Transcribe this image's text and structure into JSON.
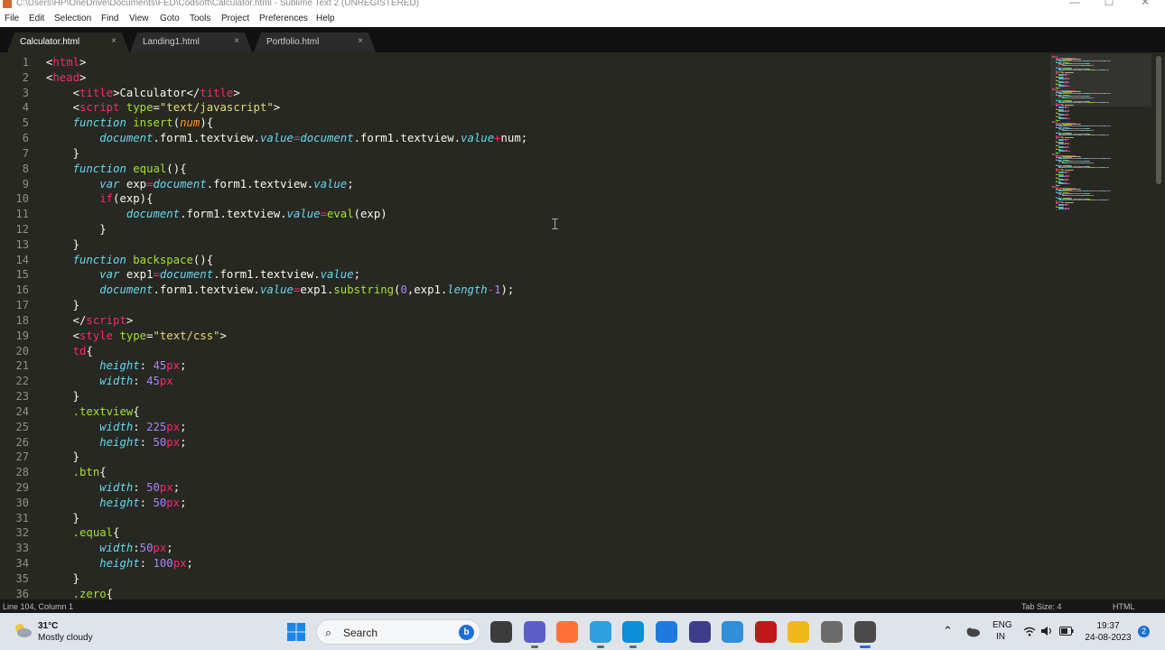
{
  "window": {
    "title": "C:\\Users\\HP\\OneDrive\\Documents\\FED\\Codsoft\\Calculator.html - Sublime Text 2 (UNREGISTERED)",
    "minimize": "—",
    "maximize": "☐",
    "close": "✕"
  },
  "menu": [
    "File",
    "Edit",
    "Selection",
    "Find",
    "View",
    "Goto",
    "Tools",
    "Project",
    "Preferences",
    "Help"
  ],
  "tabs": [
    {
      "label": "Calculator.html",
      "active": true,
      "close": "×"
    },
    {
      "label": "Landing1.html",
      "active": false,
      "close": "×"
    },
    {
      "label": "Portfolio.html",
      "active": false,
      "close": "×"
    }
  ],
  "line_numbers": [
    "1",
    "2",
    "3",
    "4",
    "5",
    "6",
    "7",
    "8",
    "9",
    "10",
    "11",
    "12",
    "13",
    "14",
    "15",
    "16",
    "17",
    "18",
    "19",
    "20",
    "21",
    "22",
    "23",
    "24",
    "25",
    "26",
    "27",
    "28",
    "29",
    "30",
    "31",
    "32",
    "33",
    "34",
    "35",
    "36"
  ],
  "code_lines": [
    [
      [
        "p",
        "<"
      ],
      [
        "tag",
        "html"
      ],
      [
        "p",
        ">"
      ]
    ],
    [
      [
        "p",
        "<"
      ],
      [
        "tag",
        "head"
      ],
      [
        "p",
        ">"
      ]
    ],
    [
      [
        "p",
        "    <"
      ],
      [
        "tag",
        "title"
      ],
      [
        "p",
        ">Calculator</"
      ],
      [
        "tag",
        "title"
      ],
      [
        "p",
        ">"
      ]
    ],
    [
      [
        "p",
        "    <"
      ],
      [
        "tag",
        "script"
      ],
      [
        "p",
        " "
      ],
      [
        "fn",
        "type"
      ],
      [
        "p",
        "="
      ],
      [
        "str",
        "\"text/javascript\""
      ],
      [
        "p",
        ">"
      ]
    ],
    [
      [
        "p",
        "    "
      ],
      [
        "kw",
        "function"
      ],
      [
        "p",
        " "
      ],
      [
        "fn",
        "insert"
      ],
      [
        "p",
        "("
      ],
      [
        "arg",
        "num"
      ],
      [
        "p",
        "){"
      ]
    ],
    [
      [
        "p",
        "        "
      ],
      [
        "builtin",
        "document"
      ],
      [
        "p",
        ".form1.textview."
      ],
      [
        "prop",
        "value"
      ],
      [
        "op",
        "="
      ],
      [
        "builtin",
        "document"
      ],
      [
        "p",
        ".form1.textview."
      ],
      [
        "prop",
        "value"
      ],
      [
        "op",
        "+"
      ],
      [
        "p",
        "num;"
      ]
    ],
    [
      [
        "p",
        "    }"
      ]
    ],
    [
      [
        "p",
        "    "
      ],
      [
        "kw",
        "function"
      ],
      [
        "p",
        " "
      ],
      [
        "fn",
        "equal"
      ],
      [
        "p",
        "(){"
      ]
    ],
    [
      [
        "p",
        "        "
      ],
      [
        "kwv",
        "var"
      ],
      [
        "p",
        " exp"
      ],
      [
        "op",
        "="
      ],
      [
        "builtin",
        "document"
      ],
      [
        "p",
        ".form1.textview."
      ],
      [
        "prop",
        "value"
      ],
      [
        "p",
        ";"
      ]
    ],
    [
      [
        "p",
        "        "
      ],
      [
        "ctrl",
        "if"
      ],
      [
        "p",
        "(exp){"
      ]
    ],
    [
      [
        "p",
        "            "
      ],
      [
        "builtin",
        "document"
      ],
      [
        "p",
        ".form1.textview."
      ],
      [
        "prop",
        "value"
      ],
      [
        "op",
        "="
      ],
      [
        "fn",
        "eval"
      ],
      [
        "p",
        "(exp)"
      ]
    ],
    [
      [
        "p",
        "        }"
      ]
    ],
    [
      [
        "p",
        "    }"
      ]
    ],
    [
      [
        "p",
        "    "
      ],
      [
        "kw",
        "function"
      ],
      [
        "p",
        " "
      ],
      [
        "fn",
        "backspace"
      ],
      [
        "p",
        "(){"
      ]
    ],
    [
      [
        "p",
        "        "
      ],
      [
        "kwv",
        "var"
      ],
      [
        "p",
        " exp1"
      ],
      [
        "op",
        "="
      ],
      [
        "builtin",
        "document"
      ],
      [
        "p",
        ".form1.textview."
      ],
      [
        "prop",
        "value"
      ],
      [
        "p",
        ";"
      ]
    ],
    [
      [
        "p",
        "        "
      ],
      [
        "builtin",
        "document"
      ],
      [
        "p",
        ".form1.textview."
      ],
      [
        "prop",
        "value"
      ],
      [
        "op",
        "="
      ],
      [
        "p",
        "exp1."
      ],
      [
        "fn",
        "substring"
      ],
      [
        "p",
        "("
      ],
      [
        "num",
        "0"
      ],
      [
        "p",
        ",exp1."
      ],
      [
        "prop",
        "length"
      ],
      [
        "op",
        "-"
      ],
      [
        "num",
        "1"
      ],
      [
        "p",
        ");"
      ]
    ],
    [
      [
        "p",
        "    }"
      ]
    ],
    [
      [
        "p",
        "    </"
      ],
      [
        "tag",
        "script"
      ],
      [
        "p",
        ">"
      ]
    ],
    [
      [
        "p",
        "    <"
      ],
      [
        "tag",
        "style"
      ],
      [
        "p",
        " "
      ],
      [
        "fn",
        "type"
      ],
      [
        "p",
        "="
      ],
      [
        "str",
        "\"text/css\""
      ],
      [
        "p",
        ">"
      ]
    ],
    [
      [
        "p",
        "    "
      ],
      [
        "tag",
        "td"
      ],
      [
        "p",
        "{"
      ]
    ],
    [
      [
        "p",
        "        "
      ],
      [
        "prop",
        "height"
      ],
      [
        "p",
        ": "
      ],
      [
        "num",
        "45"
      ],
      [
        "unit",
        "px"
      ],
      [
        "p",
        ";"
      ]
    ],
    [
      [
        "p",
        "        "
      ],
      [
        "prop",
        "width"
      ],
      [
        "p",
        ": "
      ],
      [
        "num",
        "45"
      ],
      [
        "unit",
        "px"
      ]
    ],
    [
      [
        "p",
        "    }"
      ]
    ],
    [
      [
        "p",
        "    "
      ],
      [
        "sel",
        ".textview"
      ],
      [
        "p",
        "{"
      ]
    ],
    [
      [
        "p",
        "        "
      ],
      [
        "prop",
        "width"
      ],
      [
        "p",
        ": "
      ],
      [
        "num",
        "225"
      ],
      [
        "unit",
        "px"
      ],
      [
        "p",
        ";"
      ]
    ],
    [
      [
        "p",
        "        "
      ],
      [
        "prop",
        "height"
      ],
      [
        "p",
        ": "
      ],
      [
        "num",
        "50"
      ],
      [
        "unit",
        "px"
      ],
      [
        "p",
        ";"
      ]
    ],
    [
      [
        "p",
        "    }"
      ]
    ],
    [
      [
        "p",
        "    "
      ],
      [
        "sel",
        ".btn"
      ],
      [
        "p",
        "{"
      ]
    ],
    [
      [
        "p",
        "        "
      ],
      [
        "prop",
        "width"
      ],
      [
        "p",
        ": "
      ],
      [
        "num",
        "50"
      ],
      [
        "unit",
        "px"
      ],
      [
        "p",
        ";"
      ]
    ],
    [
      [
        "p",
        "        "
      ],
      [
        "prop",
        "height"
      ],
      [
        "p",
        ": "
      ],
      [
        "num",
        "50"
      ],
      [
        "unit",
        "px"
      ],
      [
        "p",
        ";"
      ]
    ],
    [
      [
        "p",
        "    }"
      ]
    ],
    [
      [
        "p",
        "    "
      ],
      [
        "sel",
        ".equal"
      ],
      [
        "p",
        "{"
      ]
    ],
    [
      [
        "p",
        "        "
      ],
      [
        "prop",
        "width"
      ],
      [
        "p",
        ":"
      ],
      [
        "num",
        "50"
      ],
      [
        "unit",
        "px"
      ],
      [
        "p",
        ";"
      ]
    ],
    [
      [
        "p",
        "        "
      ],
      [
        "prop",
        "height"
      ],
      [
        "p",
        ": "
      ],
      [
        "num",
        "100"
      ],
      [
        "unit",
        "px"
      ],
      [
        "p",
        ";"
      ]
    ],
    [
      [
        "p",
        "    }"
      ]
    ],
    [
      [
        "p",
        "    "
      ],
      [
        "sel",
        ".zero"
      ],
      [
        "p",
        "{"
      ]
    ]
  ],
  "status": {
    "position": "Line 104, Column 1",
    "tab_size": "Tab Size: 4",
    "syntax": "HTML"
  },
  "taskbar": {
    "weather_temp": "31°C",
    "weather_desc": "Mostly cloudy",
    "search_label": "Search",
    "bing_label": "b",
    "apps": [
      {
        "name": "task-view",
        "color": "#3b3b3b"
      },
      {
        "name": "teams",
        "color": "#5b5fc7"
      },
      {
        "name": "firefox",
        "color": "#ff7139"
      },
      {
        "name": "edge-dev",
        "color": "#2f9fe0"
      },
      {
        "name": "edge",
        "color": "#0c8ed9"
      },
      {
        "name": "store",
        "color": "#1f7ae0"
      },
      {
        "name": "app-7",
        "color": "#3d3d8a"
      },
      {
        "name": "app-8",
        "color": "#2f8fd8"
      },
      {
        "name": "mcafee",
        "color": "#c01818"
      },
      {
        "name": "file-explorer",
        "color": "#f2b81b"
      },
      {
        "name": "app-11",
        "color": "#6b6b6b"
      },
      {
        "name": "sublime-text",
        "color": "#4a4a4a"
      }
    ],
    "lang_1": "ENG",
    "lang_2": "IN",
    "time": "19:37",
    "date": "24-08-2023",
    "notifications": "2",
    "chevron": "⌃"
  }
}
